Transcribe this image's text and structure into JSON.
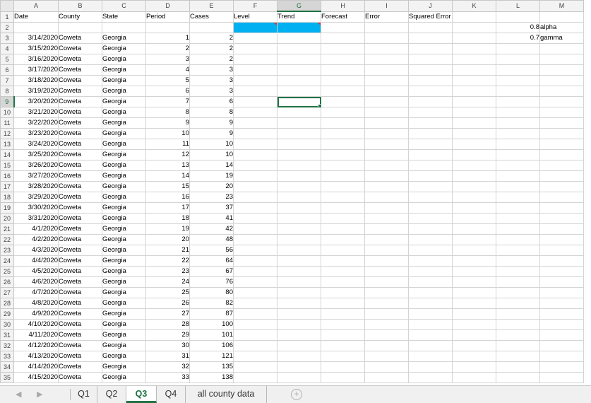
{
  "columns": [
    "A",
    "B",
    "C",
    "D",
    "E",
    "F",
    "G",
    "H",
    "I",
    "J",
    "K",
    "L",
    "M"
  ],
  "selected_column": "G",
  "selected_row": 9,
  "header_row": [
    "Date",
    "County",
    "State",
    "Period",
    "Cases",
    "Level",
    "Trend",
    "Forecast",
    "Error",
    "Squared Error",
    "",
    "",
    ""
  ],
  "params": {
    "alpha_value": "0.8",
    "alpha_label": "alpha",
    "gamma_value": "0.7",
    "gamma_label": "gamma"
  },
  "rows": [
    {
      "date": "3/14/2020",
      "county": "Coweta",
      "state": "Georgia",
      "period": "1",
      "cases": "2"
    },
    {
      "date": "3/15/2020",
      "county": "Coweta",
      "state": "Georgia",
      "period": "2",
      "cases": "2"
    },
    {
      "date": "3/16/2020",
      "county": "Coweta",
      "state": "Georgia",
      "period": "3",
      "cases": "2"
    },
    {
      "date": "3/17/2020",
      "county": "Coweta",
      "state": "Georgia",
      "period": "4",
      "cases": "3"
    },
    {
      "date": "3/18/2020",
      "county": "Coweta",
      "state": "Georgia",
      "period": "5",
      "cases": "3"
    },
    {
      "date": "3/19/2020",
      "county": "Coweta",
      "state": "Georgia",
      "period": "6",
      "cases": "3"
    },
    {
      "date": "3/20/2020",
      "county": "Coweta",
      "state": "Georgia",
      "period": "7",
      "cases": "6"
    },
    {
      "date": "3/21/2020",
      "county": "Coweta",
      "state": "Georgia",
      "period": "8",
      "cases": "8"
    },
    {
      "date": "3/22/2020",
      "county": "Coweta",
      "state": "Georgia",
      "period": "9",
      "cases": "9"
    },
    {
      "date": "3/23/2020",
      "county": "Coweta",
      "state": "Georgia",
      "period": "10",
      "cases": "9"
    },
    {
      "date": "3/24/2020",
      "county": "Coweta",
      "state": "Georgia",
      "period": "11",
      "cases": "10"
    },
    {
      "date": "3/25/2020",
      "county": "Coweta",
      "state": "Georgia",
      "period": "12",
      "cases": "10"
    },
    {
      "date": "3/26/2020",
      "county": "Coweta",
      "state": "Georgia",
      "period": "13",
      "cases": "14"
    },
    {
      "date": "3/27/2020",
      "county": "Coweta",
      "state": "Georgia",
      "period": "14",
      "cases": "19"
    },
    {
      "date": "3/28/2020",
      "county": "Coweta",
      "state": "Georgia",
      "period": "15",
      "cases": "20"
    },
    {
      "date": "3/29/2020",
      "county": "Coweta",
      "state": "Georgia",
      "period": "16",
      "cases": "23"
    },
    {
      "date": "3/30/2020",
      "county": "Coweta",
      "state": "Georgia",
      "period": "17",
      "cases": "37"
    },
    {
      "date": "3/31/2020",
      "county": "Coweta",
      "state": "Georgia",
      "period": "18",
      "cases": "41"
    },
    {
      "date": "4/1/2020",
      "county": "Coweta",
      "state": "Georgia",
      "period": "19",
      "cases": "42"
    },
    {
      "date": "4/2/2020",
      "county": "Coweta",
      "state": "Georgia",
      "period": "20",
      "cases": "48"
    },
    {
      "date": "4/3/2020",
      "county": "Coweta",
      "state": "Georgia",
      "period": "21",
      "cases": "56"
    },
    {
      "date": "4/4/2020",
      "county": "Coweta",
      "state": "Georgia",
      "period": "22",
      "cases": "64"
    },
    {
      "date": "4/5/2020",
      "county": "Coweta",
      "state": "Georgia",
      "period": "23",
      "cases": "67"
    },
    {
      "date": "4/6/2020",
      "county": "Coweta",
      "state": "Georgia",
      "period": "24",
      "cases": "76"
    },
    {
      "date": "4/7/2020",
      "county": "Coweta",
      "state": "Georgia",
      "period": "25",
      "cases": "80"
    },
    {
      "date": "4/8/2020",
      "county": "Coweta",
      "state": "Georgia",
      "period": "26",
      "cases": "82"
    },
    {
      "date": "4/9/2020",
      "county": "Coweta",
      "state": "Georgia",
      "period": "27",
      "cases": "87"
    },
    {
      "date": "4/10/2020",
      "county": "Coweta",
      "state": "Georgia",
      "period": "28",
      "cases": "100"
    },
    {
      "date": "4/11/2020",
      "county": "Coweta",
      "state": "Georgia",
      "period": "29",
      "cases": "101"
    },
    {
      "date": "4/12/2020",
      "county": "Coweta",
      "state": "Georgia",
      "period": "30",
      "cases": "106"
    },
    {
      "date": "4/13/2020",
      "county": "Coweta",
      "state": "Georgia",
      "period": "31",
      "cases": "121"
    },
    {
      "date": "4/14/2020",
      "county": "Coweta",
      "state": "Georgia",
      "period": "32",
      "cases": "135"
    },
    {
      "date": "4/15/2020",
      "county": "Coweta",
      "state": "Georgia",
      "period": "33",
      "cases": "138"
    }
  ],
  "tabs": [
    "Q1",
    "Q2",
    "Q3",
    "Q4",
    "all county data"
  ],
  "active_tab": "Q3",
  "add_sheet_symbol": "+",
  "nav_prev": "◀",
  "nav_next": "▶",
  "colors": {
    "accent": "#217346",
    "highlight": "#00b0f0",
    "comment_marker": "#e03030"
  }
}
